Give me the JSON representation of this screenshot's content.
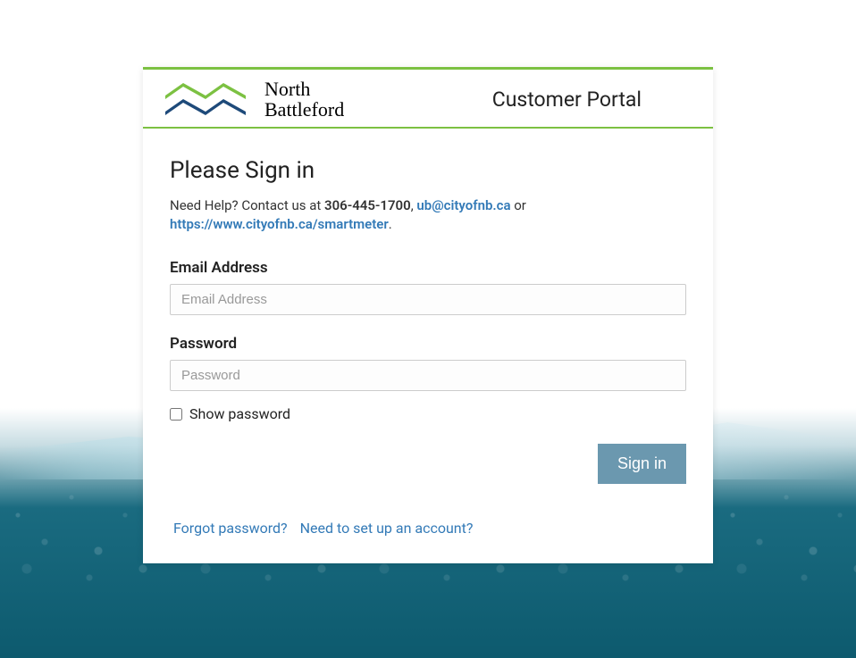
{
  "header": {
    "logo_line1": "North",
    "logo_line2": "Battleford",
    "portal_title": "Customer Portal"
  },
  "signin": {
    "title": "Please Sign in",
    "help_prefix": "Need Help? Contact us at ",
    "help_phone": "306-445-1700",
    "help_sep1": ", ",
    "help_email": "ub@cityofnb.ca",
    "help_sep2": " or ",
    "help_url_text": "https://www.cityofnb.ca/smartmeter",
    "help_suffix": ".",
    "email_label": "Email Address",
    "email_placeholder": "Email Address",
    "password_label": "Password",
    "password_placeholder": "Password",
    "show_password_label": "Show password",
    "signin_button": "Sign in",
    "forgot_link": "Forgot password?",
    "setup_link": "Need to set up an account?"
  },
  "colors": {
    "green": "#7cc142",
    "blue_dark": "#1e4a7a",
    "link": "#337ab7",
    "button": "#6b98af"
  }
}
